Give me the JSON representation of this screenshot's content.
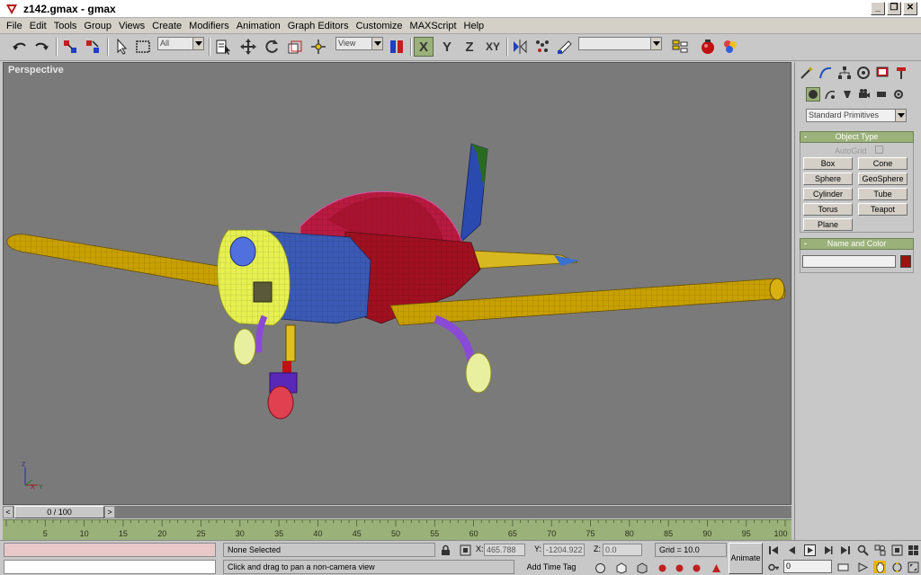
{
  "window": {
    "title": "z142.gmax - gmax"
  },
  "menu": [
    "File",
    "Edit",
    "Tools",
    "Group",
    "Views",
    "Create",
    "Modifiers",
    "Animation",
    "Graph Editors",
    "Customize",
    "MAXScript",
    "Help"
  ],
  "toolbar": {
    "selection_filter": "All",
    "reference_coord": "View",
    "axis_x": "X",
    "axis_y": "Y",
    "axis_z": "Z",
    "axis_xy": "XY",
    "named_selection": ""
  },
  "viewport": {
    "label": "Perspective",
    "axis_x": "X",
    "axis_y": "Y",
    "axis_z": "Z"
  },
  "command_panel": {
    "category": "Standard Primitives",
    "object_type_title": "Object Type",
    "autogrid_label": "AutoGrid",
    "primitives": [
      "Box",
      "Cone",
      "Sphere",
      "GeoSphere",
      "Cylinder",
      "Tube",
      "Torus",
      "Teapot",
      "Plane"
    ],
    "name_color_title": "Name and Color",
    "name_value": "",
    "color": "#a01010"
  },
  "timeline": {
    "frame_display": "0 / 100",
    "ruler_ticks": [
      "5",
      "10",
      "15",
      "20",
      "25",
      "30",
      "35",
      "40",
      "45",
      "50",
      "55",
      "60",
      "65",
      "70",
      "75",
      "80",
      "85",
      "90",
      "95",
      "100"
    ]
  },
  "status": {
    "selection": "None Selected",
    "prompt": "Click and drag to pan a non-camera view",
    "x_label": "X:",
    "x_value": "465.788",
    "y_label": "Y:",
    "y_value": "-1204.922",
    "z_label": "Z:",
    "z_value": "0.0",
    "grid": "Grid = 10.0",
    "animate": "Animate",
    "add_time_tag": "Add Time Tag",
    "frame": "0"
  },
  "colors": {
    "accent_green": "#9bb17a",
    "viewport_bg": "#7a7a7a",
    "wing": "#c8a000",
    "cowl": "#e6f050",
    "fuselage_blue": "#3a5ab4",
    "fuselage_red": "#a01020",
    "canopy": "#c02060",
    "tail_green": "#2a6a20",
    "gear_purple": "#7a3ac8"
  }
}
